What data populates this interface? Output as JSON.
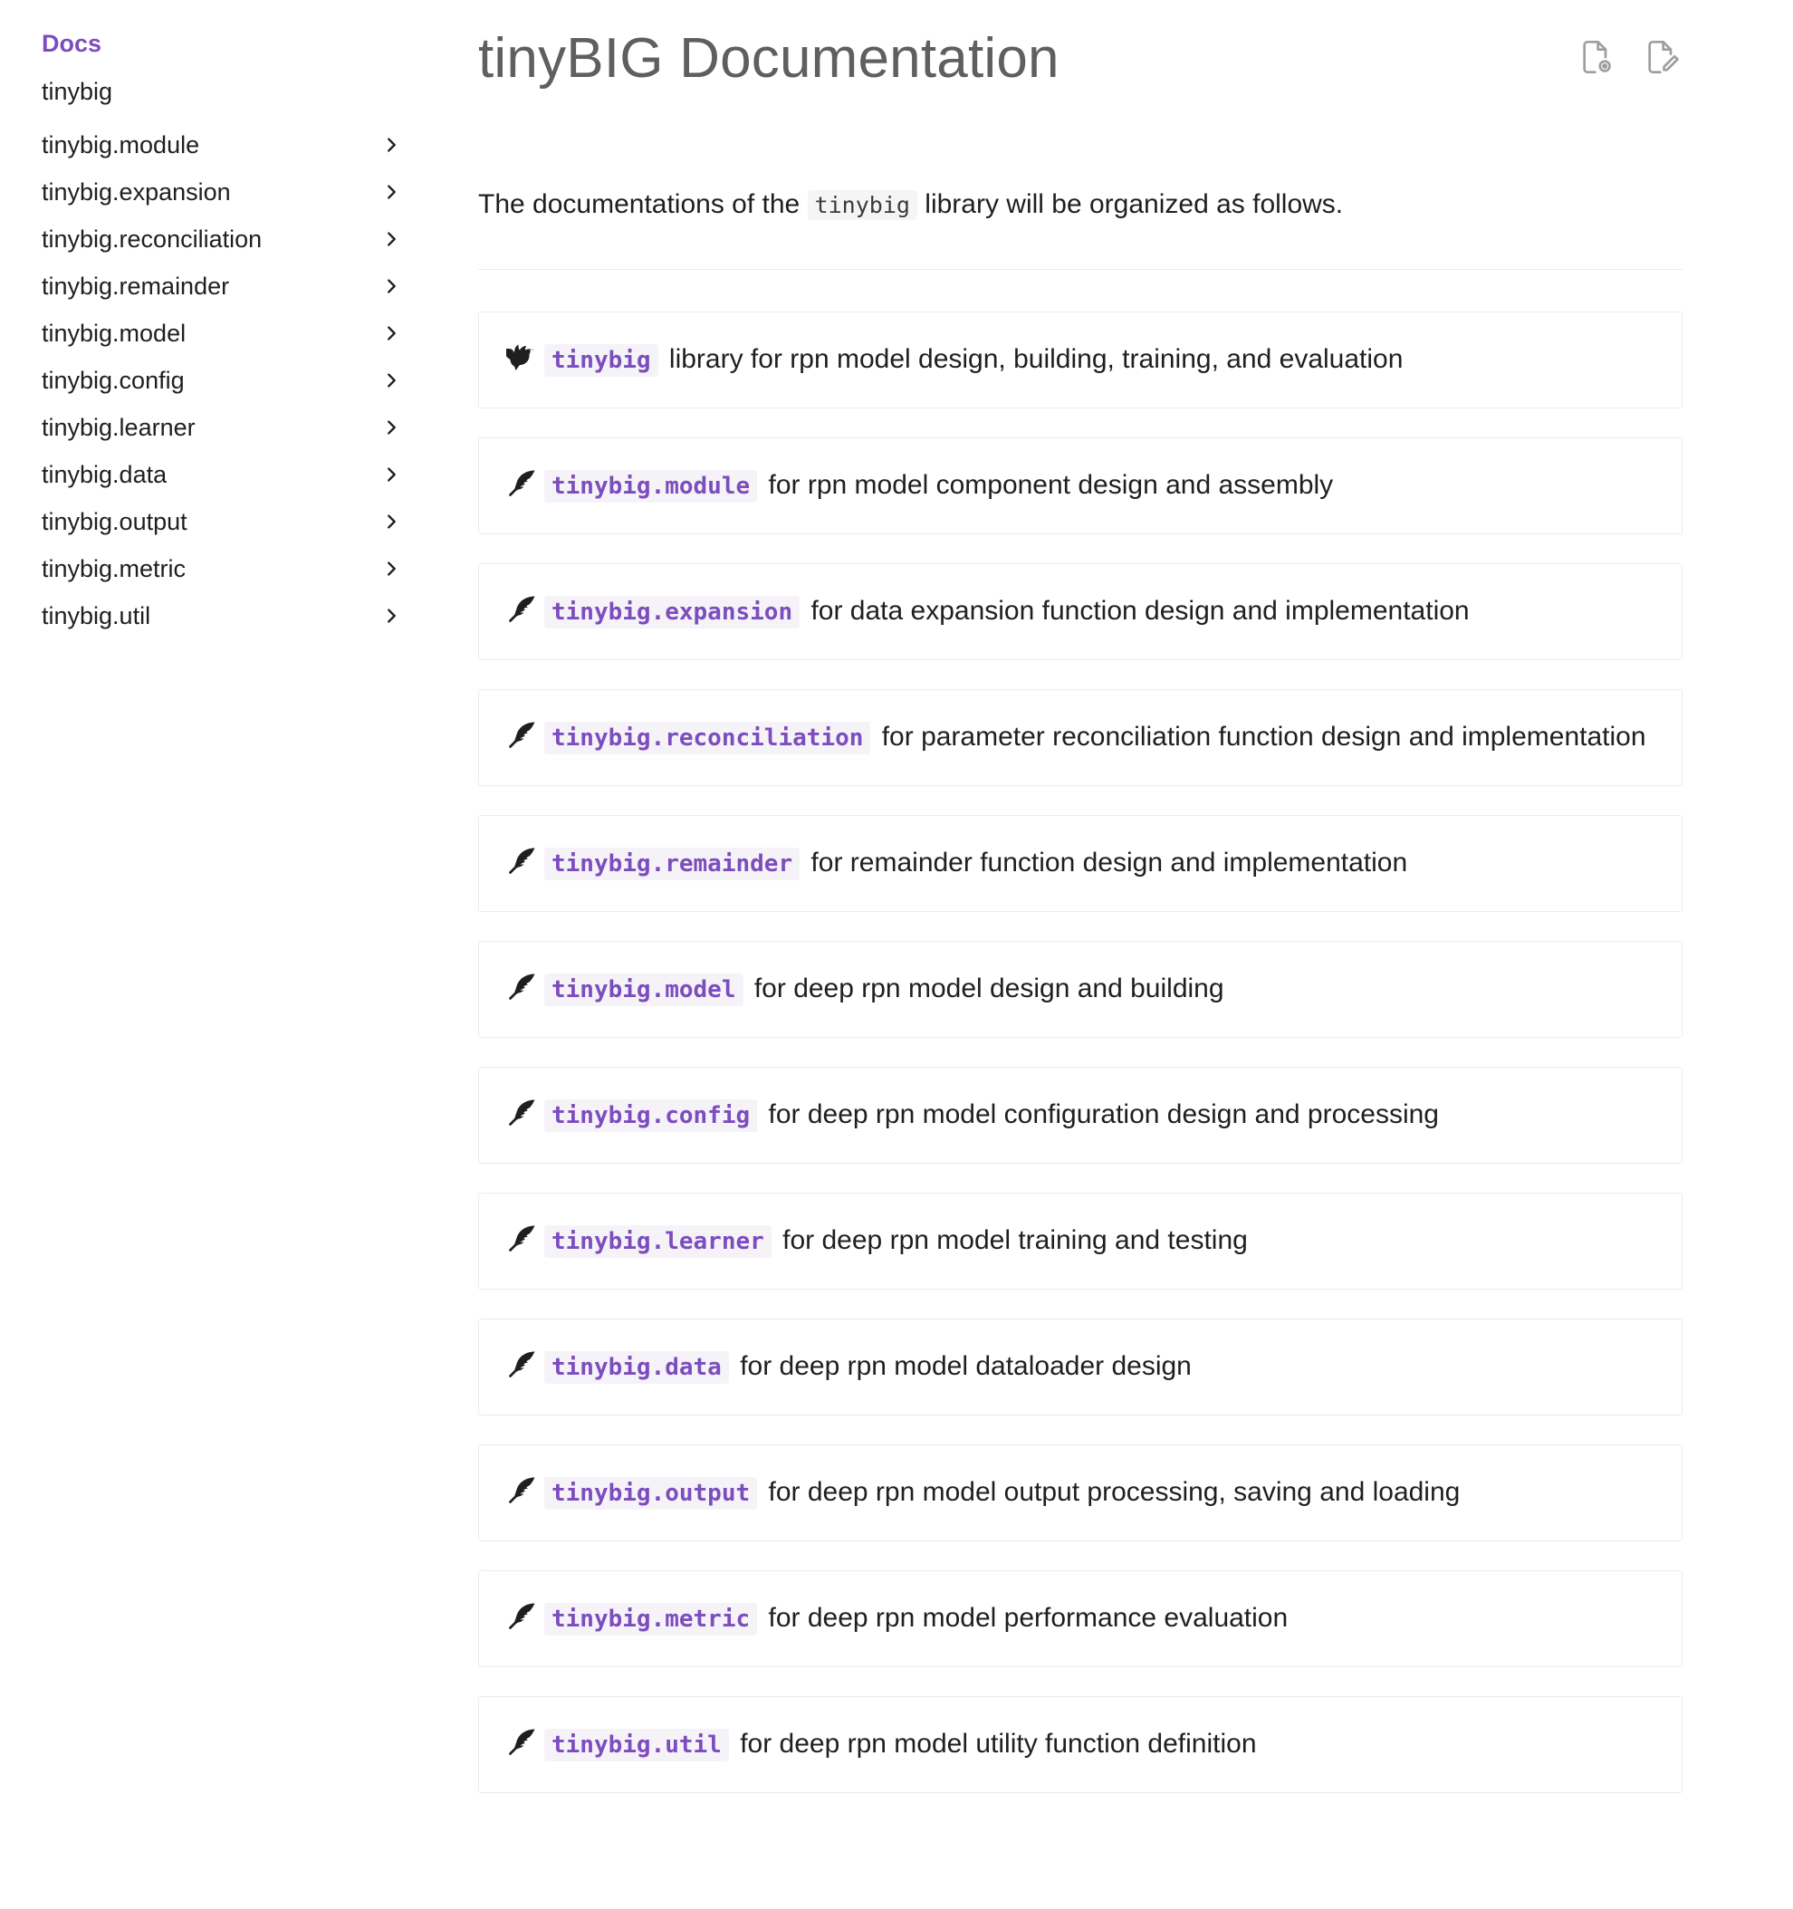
{
  "sidebar": {
    "heading": "Docs",
    "items": [
      {
        "label": "tinybig",
        "expandable": false
      },
      {
        "label": "tinybig.module",
        "expandable": true
      },
      {
        "label": "tinybig.expansion",
        "expandable": true
      },
      {
        "label": "tinybig.reconciliation",
        "expandable": true
      },
      {
        "label": "tinybig.remainder",
        "expandable": true
      },
      {
        "label": "tinybig.model",
        "expandable": true
      },
      {
        "label": "tinybig.config",
        "expandable": true
      },
      {
        "label": "tinybig.learner",
        "expandable": true
      },
      {
        "label": "tinybig.data",
        "expandable": true
      },
      {
        "label": "tinybig.output",
        "expandable": true
      },
      {
        "label": "tinybig.metric",
        "expandable": true
      },
      {
        "label": "tinybig.util",
        "expandable": true
      }
    ]
  },
  "main": {
    "title": "tinyBIG Documentation",
    "actions": [
      {
        "icon": "view-source-icon"
      },
      {
        "icon": "edit-page-icon"
      }
    ],
    "intro": {
      "before": "The documentations of the",
      "code": "tinybig",
      "after": "library will be organized as follows."
    },
    "cards": [
      {
        "icon": "bird-icon",
        "code": "tinybig",
        "text": "library for rpn model design, building, training, and evaluation"
      },
      {
        "icon": "feather-icon",
        "code": "tinybig.module",
        "text": "for rpn model component design and assembly"
      },
      {
        "icon": "feather-icon",
        "code": "tinybig.expansion",
        "text": "for data expansion function design and implementation"
      },
      {
        "icon": "feather-icon",
        "code": "tinybig.reconciliation",
        "text": "for parameter reconciliation function design and implementation"
      },
      {
        "icon": "feather-icon",
        "code": "tinybig.remainder",
        "text": "for remainder function design and implementation"
      },
      {
        "icon": "feather-icon",
        "code": "tinybig.model",
        "text": "for deep rpn model design and building"
      },
      {
        "icon": "feather-icon",
        "code": "tinybig.config",
        "text": "for deep rpn model configuration design and processing"
      },
      {
        "icon": "feather-icon",
        "code": "tinybig.learner",
        "text": "for deep rpn model training and testing"
      },
      {
        "icon": "feather-icon",
        "code": "tinybig.data",
        "text": "for deep rpn model dataloader design"
      },
      {
        "icon": "feather-icon",
        "code": "tinybig.output",
        "text": "for deep rpn model output processing, saving and loading"
      },
      {
        "icon": "feather-icon",
        "code": "tinybig.metric",
        "text": "for deep rpn model performance evaluation"
      },
      {
        "icon": "feather-icon",
        "code": "tinybig.util",
        "text": "for deep rpn model utility function definition"
      }
    ]
  },
  "colors": {
    "accent": "#7c4dbe",
    "title": "#5f5f5f",
    "border": "#ececec"
  }
}
